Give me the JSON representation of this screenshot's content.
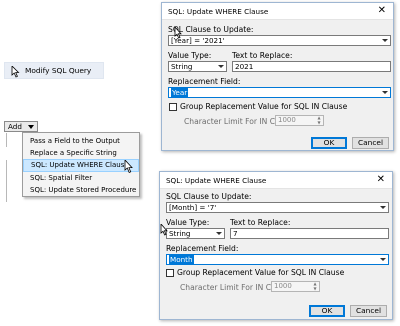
{
  "left_panel": {
    "modify_sql_query_label": "Modify SQL Query",
    "add_button_label": "Add",
    "menu_items": [
      "Pass a Field to the Output",
      "Replace a Specific String",
      "SQL: Update WHERE Clause",
      "SQL: Spatial Filter",
      "SQL: Update Stored Procedure"
    ],
    "selected_menu_item": "SQL: Update WHERE Clause"
  },
  "dialogs": [
    {
      "title": "SQL: Update WHERE Clause",
      "close_glyph": "✕",
      "sql_clause_label": "SQL Clause to Update:",
      "sql_clause_value": "[Year] = '2021'",
      "value_type_label": "Value Type:",
      "value_type_value": "String",
      "text_to_replace_label": "Text to Replace:",
      "text_to_replace_value": "2021",
      "replacement_field_label": "Replacement Field:",
      "replacement_field_value": "Year",
      "group_replacement_label": "Group Replacement Value for SQL IN Clause",
      "character_limit_label": "Character Limit For IN Clause:",
      "character_limit_value": "1000",
      "ok_label": "OK",
      "cancel_label": "Cancel"
    },
    {
      "title": "SQL: Update WHERE Clause",
      "close_glyph": "✕",
      "sql_clause_label": "SQL Clause to Update:",
      "sql_clause_value": "[Month] = '7'",
      "value_type_label": "Value Type:",
      "value_type_value": "String",
      "text_to_replace_label": "Text to Replace:",
      "text_to_replace_value": "7",
      "replacement_field_label": "Replacement Field:",
      "replacement_field_value": "Month",
      "group_replacement_label": "Group Replacement Value for SQL IN Clause",
      "character_limit_label": "Character Limit For IN Clause:",
      "character_limit_value": "1000",
      "ok_label": "OK",
      "cancel_label": "Cancel"
    }
  ],
  "colors": {
    "selection_blue": "#0078d7",
    "menu_highlight": "#cce8ff",
    "dialog_bg": "#f0f0f0",
    "modify_row_bg": "#e9eef6"
  }
}
